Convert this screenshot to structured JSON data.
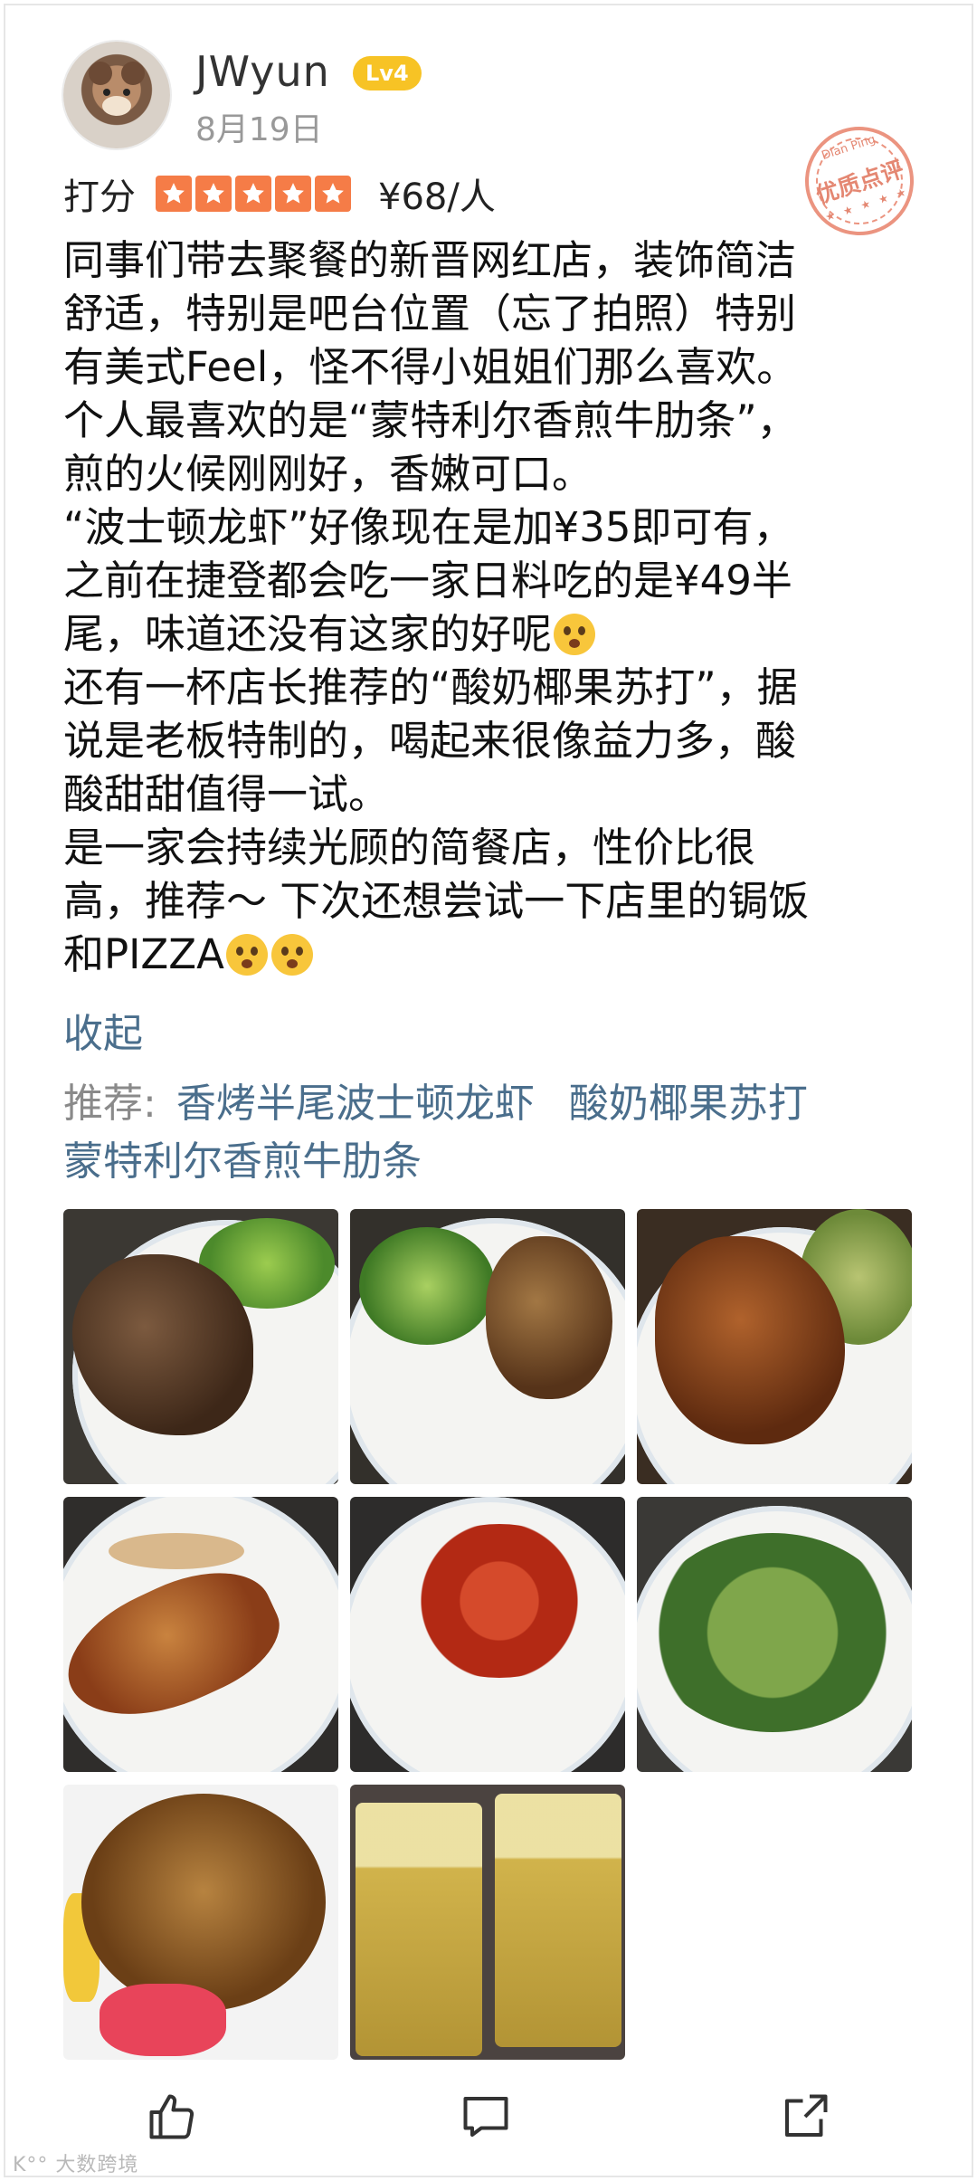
{
  "user": {
    "name": "JWyun",
    "level": "Lv4",
    "date": "8月19日"
  },
  "badge": {
    "top": "Dian Ping",
    "main": "优质点评",
    "bottom": "★ ★ ★ ★ ★"
  },
  "rating": {
    "label": "打分",
    "stars": 5,
    "price": "¥68/人",
    "star_color": "#f57c47"
  },
  "review_lines": [
    "同事们带去聚餐的新晋网红店，装饰简洁",
    "舒适，特别是吧台位置（忘了拍照）特别",
    "有美式Feel，怪不得小姐姐们那么喜欢。",
    "个人最喜欢的是“蒙特利尔香煎牛肋条”，",
    "煎的火候刚刚好，香嫩可口。",
    "“波士顿龙虾”好像现在是加¥35即可有，",
    "之前在捷登都会吃一家日料吃的是¥49半",
    "尾，味道还没有这家的好呢",
    "还有一杯店长推荐的“酸奶椰果苏打”，据",
    "说是老板特制的，喝起来很像益力多，酸",
    "酸甜甜值得一试。",
    "是一家会持续光顾的简餐店，性价比很",
    "高，推荐～ 下次还想尝试一下店里的锔饭",
    "和PIZZA"
  ],
  "collapse_label": "收起",
  "recommend": {
    "label": "推荐:",
    "dishes": [
      "香烤半尾波士顿龙虾",
      "酸奶椰果苏打",
      "蒙特利尔香煎牛肋条"
    ]
  },
  "photos": [
    "steak-plate",
    "chicken-plate",
    "beef-ribs-plate",
    "lobster-plate",
    "spaghetti-plate",
    "salad-plate",
    "baked-rice",
    "iced-drinks"
  ],
  "actions": [
    "like-icon",
    "comment-icon",
    "share-icon"
  ],
  "watermark": "K°° 大数跨境",
  "colors": {
    "link": "#4a6e8c",
    "level_badge": "#f7c325",
    "stamp": "#e8826a"
  }
}
